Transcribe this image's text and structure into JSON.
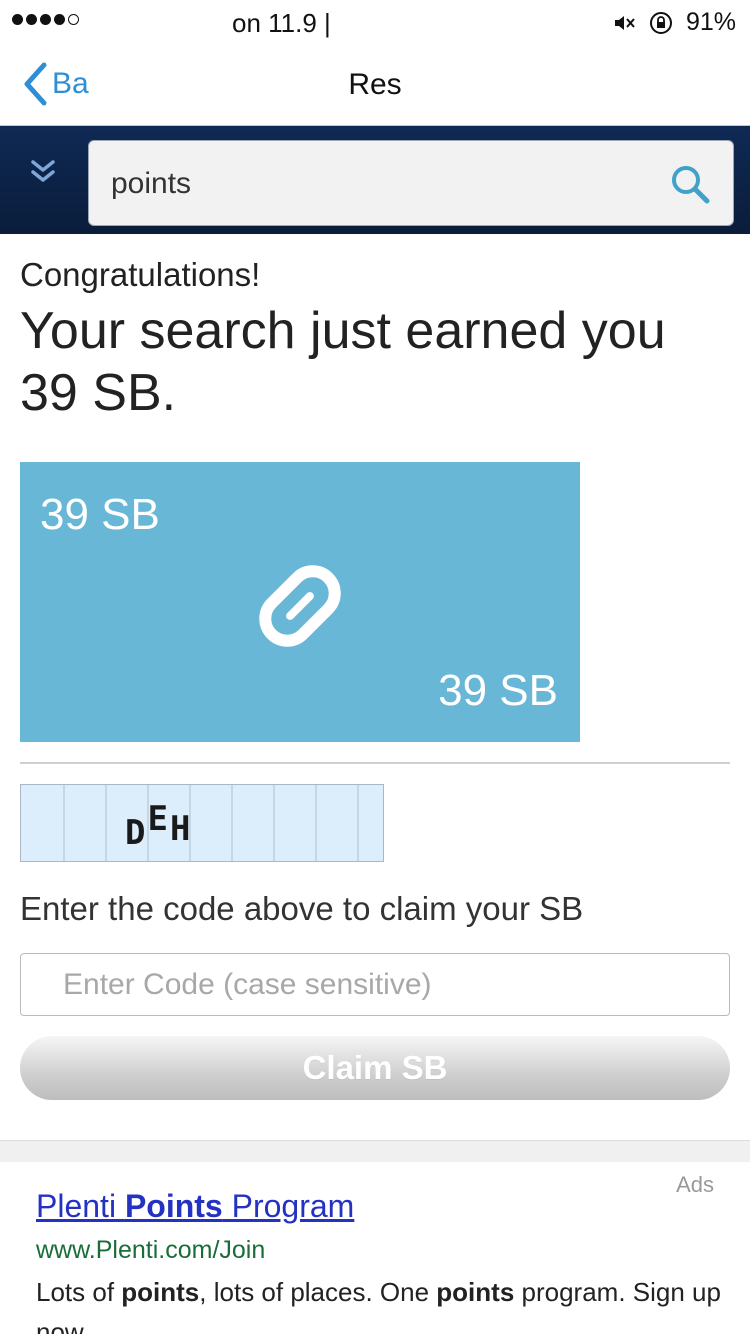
{
  "status_bar": {
    "center_text": "on 11.9 |",
    "battery": "91%"
  },
  "nav": {
    "back_label": "Ba",
    "title": "Res"
  },
  "search": {
    "value": "points"
  },
  "reward": {
    "congrats": "Congratulations!",
    "headline": "Your search just earned you 39 SB.",
    "card_amount_top": "39 SB",
    "card_amount_bottom": "39 SB",
    "card_color": "#69b7d6"
  },
  "captcha": {
    "code_chars": [
      "D",
      "E",
      "H"
    ]
  },
  "claim": {
    "instructions": "Enter the code above to claim your SB",
    "input_placeholder": "Enter Code (case sensitive)",
    "input_value": "",
    "button_label": "Claim SB"
  },
  "ad": {
    "label": "Ads",
    "title_pre": "Plenti ",
    "title_bold": "Points",
    "title_post": " Program",
    "url": "www.Plenti.com/Join",
    "desc_1": "Lots of ",
    "desc_2": "points",
    "desc_3": ", lots of places. One ",
    "desc_4": "points",
    "desc_5": " program. Sign up now."
  },
  "colors": {
    "header_bg": "#0f2a55",
    "link_blue": "#2f8fd6",
    "ad_link": "#2432c4",
    "ad_url": "#1a6d3a"
  },
  "icons": {
    "back": "chevron-left-icon",
    "search": "search-icon",
    "collapse": "double-chevron-down-icon",
    "mute": "mute-icon",
    "rotation_lock": "rotation-lock-icon",
    "logo": "swagbucks-logo-icon"
  }
}
